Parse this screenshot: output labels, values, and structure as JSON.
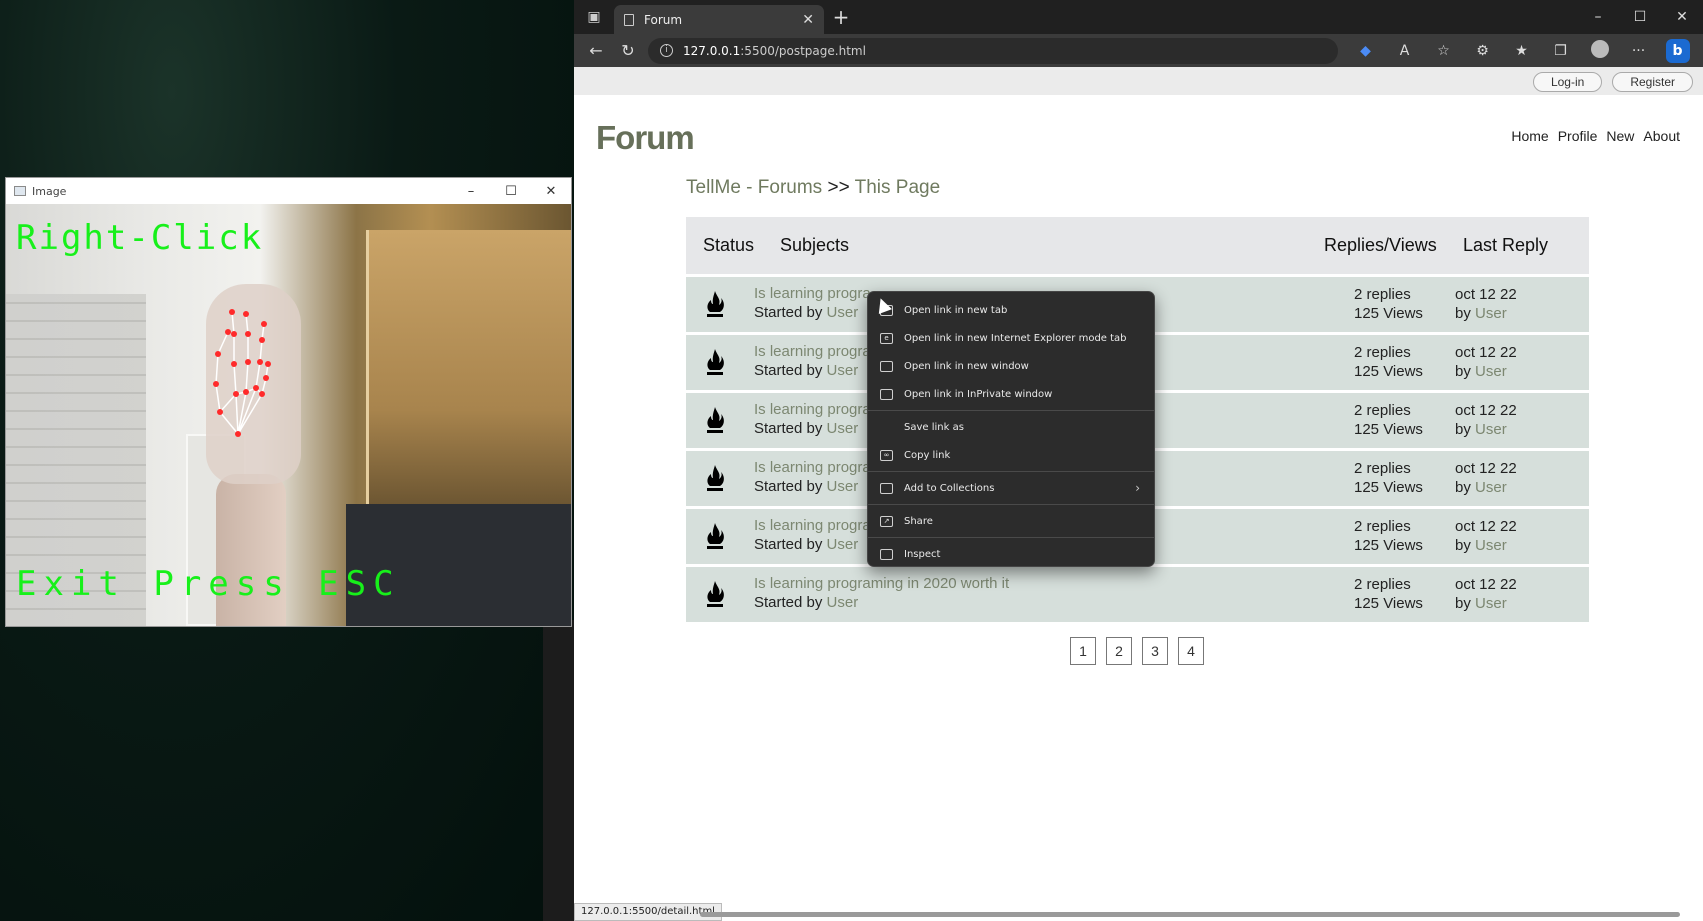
{
  "camera_window": {
    "title": "Image",
    "controls": [
      "–",
      "☐",
      "✕"
    ],
    "overlay_top": "Right-Click",
    "overlay_bottom": "Exit Press ESC"
  },
  "browser": {
    "tab_title": "Forum",
    "url_host": "127.0.0.1",
    "url_path": ":5500/postpage.html",
    "status_url": "127.0.0.1:5500/detail.html"
  },
  "site": {
    "auth": {
      "login": "Log-in",
      "register": "Register"
    },
    "logo": "Forum",
    "nav": [
      "Home",
      "Profile",
      "New",
      "About"
    ],
    "breadcrumb": {
      "root": "TellMe - Forums",
      "sep": ">>",
      "current": "This Page"
    },
    "table_headers": {
      "status": "Status",
      "subjects": "Subjects",
      "replies_views": "Replies/Views",
      "last_reply": "Last Reply"
    },
    "rows": [
      {
        "subject": "Is learning progra",
        "started_prefix": "Started by ",
        "user": "User",
        "replies": "2 replies",
        "views": "125 Views",
        "date": "oct 12 22",
        "by_prefix": "by ",
        "by_user": "User"
      },
      {
        "subject": "Is learning progra",
        "started_prefix": "Started by ",
        "user": "User",
        "replies": "2 replies",
        "views": "125 Views",
        "date": "oct 12 22",
        "by_prefix": "by ",
        "by_user": "User"
      },
      {
        "subject": "Is learning progra",
        "started_prefix": "Started by ",
        "user": "User",
        "replies": "2 replies",
        "views": "125 Views",
        "date": "oct 12 22",
        "by_prefix": "by ",
        "by_user": "User"
      },
      {
        "subject": "Is learning progra",
        "started_prefix": "Started by ",
        "user": "User",
        "replies": "2 replies",
        "views": "125 Views",
        "date": "oct 12 22",
        "by_prefix": "by ",
        "by_user": "User"
      },
      {
        "subject": "Is learning progra",
        "started_prefix": "Started by ",
        "user": "User",
        "replies": "2 replies",
        "views": "125 Views",
        "date": "oct 12 22",
        "by_prefix": "by ",
        "by_user": "User"
      },
      {
        "subject": "Is learning programing in 2020 worth it",
        "started_prefix": "Started by ",
        "user": "User",
        "replies": "2 replies",
        "views": "125 Views",
        "date": "oct 12 22",
        "by_prefix": "by ",
        "by_user": "User"
      }
    ],
    "pages": [
      "1",
      "2",
      "3",
      "4"
    ]
  },
  "context_menu": {
    "items": [
      {
        "label": "Open link in new tab",
        "icon": "new-tab-icon"
      },
      {
        "label": "Open link in new Internet Explorer mode tab",
        "icon": "ie-mode-icon"
      },
      {
        "label": "Open link in new window",
        "icon": "new-window-icon"
      },
      {
        "label": "Open link in InPrivate window",
        "icon": "inprivate-icon"
      },
      {
        "label": "Save link as",
        "icon": ""
      },
      {
        "label": "Copy link",
        "icon": "link-icon"
      },
      {
        "label": "Add to Collections",
        "icon": "collections-icon"
      },
      {
        "label": "Share",
        "icon": "share-icon"
      },
      {
        "label": "Inspect",
        "icon": "inspect-icon"
      }
    ]
  },
  "colors": {
    "accent_green": "#67705a",
    "row_bg": "#d6dfdb",
    "overlay_green": "#17f01a"
  }
}
